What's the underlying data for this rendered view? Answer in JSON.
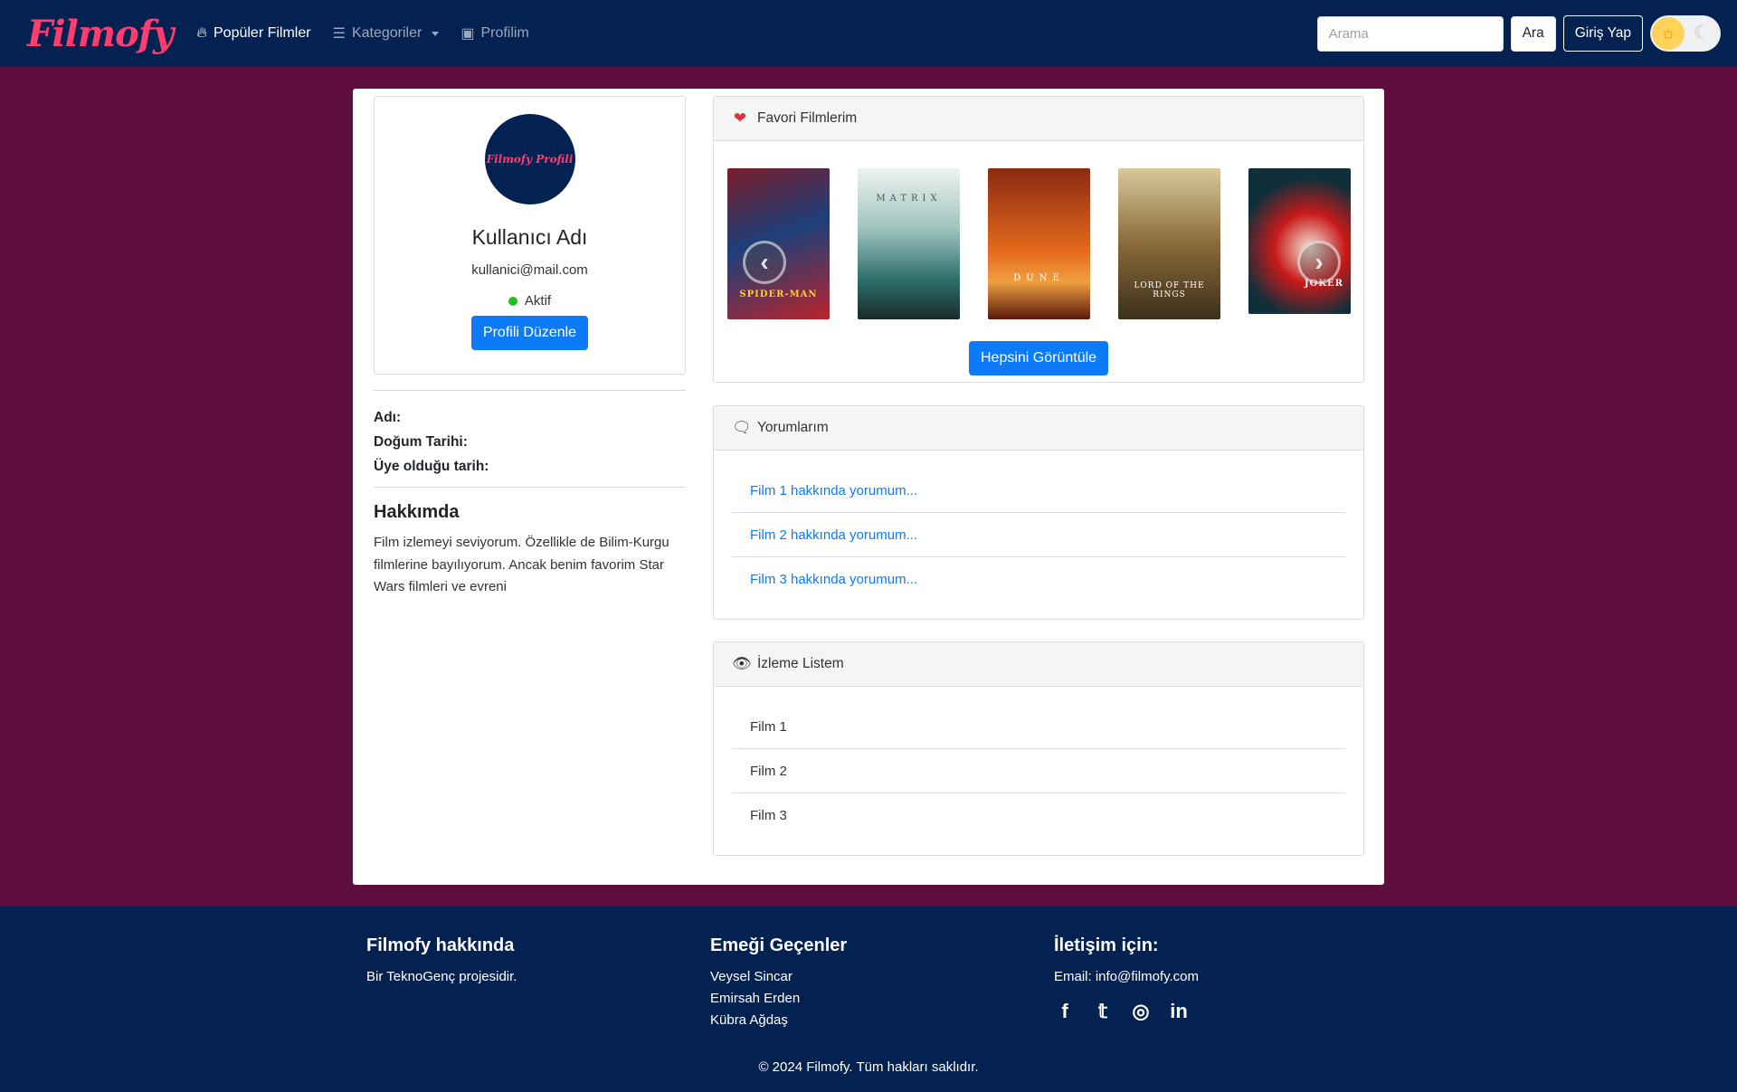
{
  "navbar": {
    "brand": "Filmofy",
    "items": [
      {
        "label": "Popüler Filmler",
        "icon": "fire-icon"
      },
      {
        "label": "Kategoriler",
        "icon": "list-icon"
      },
      {
        "label": "Profilim",
        "icon": "id-card-icon"
      }
    ],
    "search_placeholder": "Arama",
    "search_button": "Ara",
    "login_button": "Giriş Yap",
    "theme_toggle": {
      "active": "light"
    }
  },
  "profile": {
    "avatar_text": "Filmofy Profili",
    "username": "Kullanıcı Adı",
    "email": "kullanici@mail.com",
    "status": "Aktif",
    "edit_button": "Profili Düzenle",
    "fields": {
      "name_label": "Adı:",
      "birth_label": "Doğum Tarihi:",
      "member_label": "Üye olduğu tarih:"
    },
    "about_title": "Hakkımda",
    "about_text": "Film izlemeyi seviyorum. Özellikle de Bilim-Kurgu filmlerine bayılıyorum. Ancak benim favorim Star Wars filmleri ve evreni"
  },
  "favorites": {
    "title": "Favori Filmlerim",
    "posters": [
      {
        "title": "SPIDER-MAN",
        "colors": [
          "#1d3f7a",
          "#b8242a"
        ]
      },
      {
        "title": "MATRIX",
        "colors": [
          "#dce6e2",
          "#2a6b68"
        ]
      },
      {
        "title": "DUNE",
        "colors": [
          "#e46a1c",
          "#5a1a0d"
        ]
      },
      {
        "title": "LORD OF THE RINGS",
        "colors": [
          "#c8a86a",
          "#3b2f1b"
        ]
      },
      {
        "title": "JOKER",
        "colors": [
          "#0f2f3a",
          "#c81a1a"
        ]
      }
    ],
    "view_all_button": "Hepsini Görüntüle"
  },
  "comments": {
    "title": "Yorumlarım",
    "items": [
      "Film 1 hakkında yorumum...",
      "Film 2 hakkında yorumum...",
      "Film 3 hakkında yorumum..."
    ]
  },
  "watchlist": {
    "title": "İzleme Listem",
    "items": [
      "Film 1",
      "Film 2",
      "Film 3"
    ]
  },
  "footer": {
    "about_title": "Filmofy hakkında",
    "about_text": "Bir TeknoGenç projesidir.",
    "credits_title": "Emeği Geçenler",
    "credits": [
      "Veysel Sincar",
      "Emirsah Erden",
      "Kübra Ağdaş"
    ],
    "contact_title": "İletişim için:",
    "contact_email": "Email: info@filmofy.com",
    "social": [
      "facebook-icon",
      "twitter-icon",
      "instagram-icon",
      "linkedin-icon"
    ],
    "copyright": "© 2024 Filmofy. Tüm hakları saklıdır."
  },
  "colors": {
    "navbar": "#042251",
    "page_bg": "#5e0d3f",
    "brand": "#ff3d6e",
    "primary": "#0d7bf7",
    "status_active": "#20c020"
  }
}
